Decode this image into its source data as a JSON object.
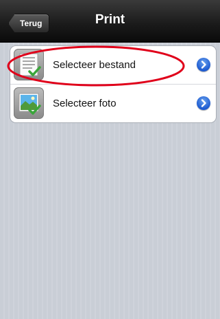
{
  "navbar": {
    "back_label": "Terug",
    "title": "Print"
  },
  "list": {
    "items": [
      {
        "label": "Selecteer bestand",
        "icon": "document-check-icon"
      },
      {
        "label": "Selecteer foto",
        "icon": "photo-check-icon"
      }
    ]
  },
  "colors": {
    "navbar": "#1c1c1c",
    "disclosure": "#1c5ad0",
    "annotation": "#e0001a",
    "background": "#c9ced6"
  }
}
